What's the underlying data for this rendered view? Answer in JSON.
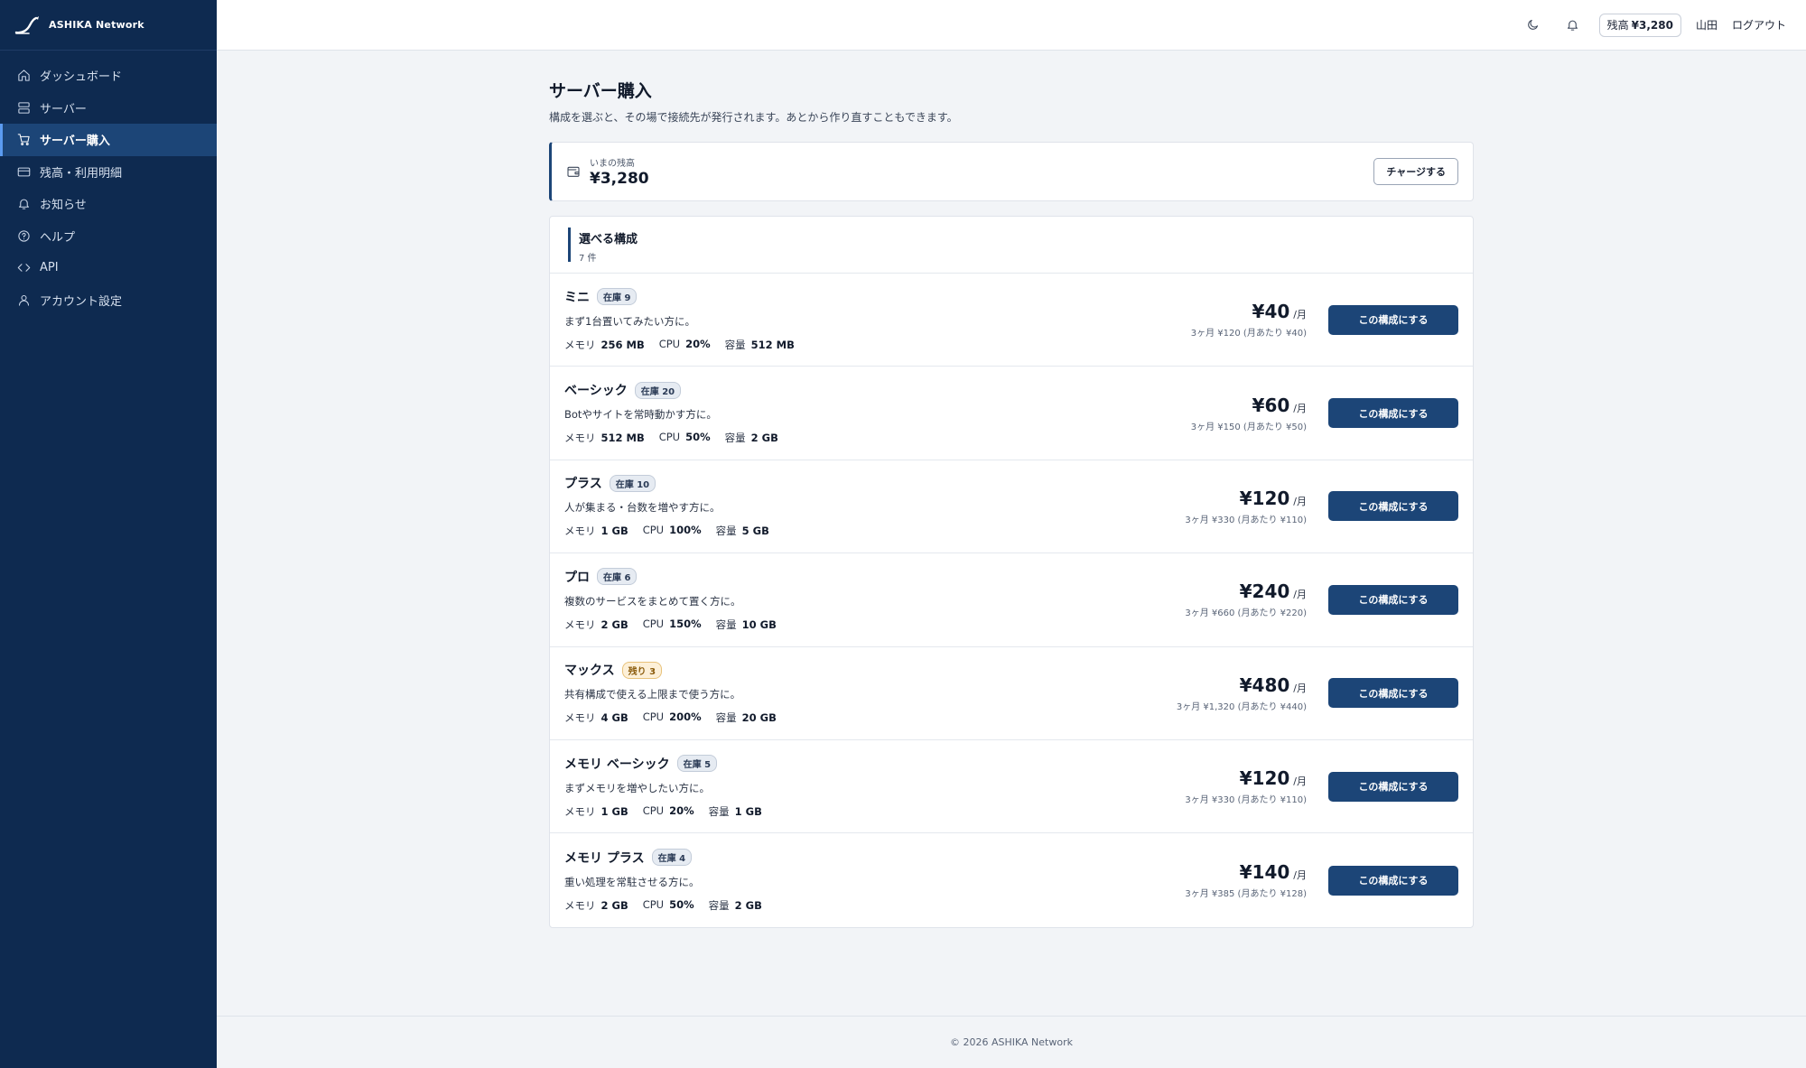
{
  "brand": {
    "name": "ASHIKA Network"
  },
  "nav": [
    {
      "label": "ダッシュボード",
      "icon": "home-icon",
      "active": false
    },
    {
      "label": "サーバー",
      "icon": "server-icon",
      "active": false
    },
    {
      "label": "サーバー購入",
      "icon": "cart-icon",
      "active": true
    },
    {
      "label": "残高・利用明細",
      "icon": "credit-card-icon",
      "active": false
    },
    {
      "label": "お知らせ",
      "icon": "bell-icon",
      "active": false
    },
    {
      "label": "ヘルプ",
      "icon": "help-circle-icon",
      "active": false
    },
    {
      "label": "API",
      "icon": "code-icon",
      "active": false
    },
    {
      "label": "アカウント設定",
      "icon": "user-icon",
      "active": false
    }
  ],
  "header": {
    "balance_label": "残高",
    "balance_value": "¥3,280",
    "user": "山田",
    "logout": "ログアウト"
  },
  "page": {
    "title": "サーバー購入",
    "description": "構成を選ぶと、その場で接続先が発行されます。あとから作り直すこともできます。"
  },
  "balance_card": {
    "label": "いまの残高",
    "amount": "¥3,280",
    "charge_label": "チャージする"
  },
  "plans": {
    "title": "選べる構成",
    "count": "7 件",
    "select_label": "この構成にする",
    "per_month": "/月",
    "spec_labels": {
      "memory": "メモリ",
      "cpu": "CPU",
      "storage": "容量"
    },
    "items": [
      {
        "name": "ミニ",
        "badge": "在庫 9",
        "badge_low": false,
        "desc": "まず1台置いてみたい方に。",
        "memory": "256 MB",
        "cpu": "20%",
        "storage": "512 MB",
        "price": "¥40",
        "sub": "3ヶ月 ¥120 (月あたり ¥40)"
      },
      {
        "name": "ベーシック",
        "badge": "在庫 20",
        "badge_low": false,
        "desc": "Botやサイトを常時動かす方に。",
        "memory": "512 MB",
        "cpu": "50%",
        "storage": "2 GB",
        "price": "¥60",
        "sub": "3ヶ月 ¥150 (月あたり ¥50)"
      },
      {
        "name": "プラス",
        "badge": "在庫 10",
        "badge_low": false,
        "desc": "人が集まる・台数を増やす方に。",
        "memory": "1 GB",
        "cpu": "100%",
        "storage": "5 GB",
        "price": "¥120",
        "sub": "3ヶ月 ¥330 (月あたり ¥110)"
      },
      {
        "name": "プロ",
        "badge": "在庫 6",
        "badge_low": false,
        "desc": "複数のサービスをまとめて置く方に。",
        "memory": "2 GB",
        "cpu": "150%",
        "storage": "10 GB",
        "price": "¥240",
        "sub": "3ヶ月 ¥660 (月あたり ¥220)"
      },
      {
        "name": "マックス",
        "badge": "残り 3",
        "badge_low": true,
        "desc": "共有構成で使える上限まで使う方に。",
        "memory": "4 GB",
        "cpu": "200%",
        "storage": "20 GB",
        "price": "¥480",
        "sub": "3ヶ月 ¥1,320 (月あたり ¥440)"
      },
      {
        "name": "メモリ ベーシック",
        "badge": "在庫 5",
        "badge_low": false,
        "desc": "まずメモリを増やしたい方に。",
        "memory": "1 GB",
        "cpu": "20%",
        "storage": "1 GB",
        "price": "¥120",
        "sub": "3ヶ月 ¥330 (月あたり ¥110)"
      },
      {
        "name": "メモリ プラス",
        "badge": "在庫 4",
        "badge_low": false,
        "desc": "重い処理を常駐させる方に。",
        "memory": "2 GB",
        "cpu": "50%",
        "storage": "2 GB",
        "price": "¥140",
        "sub": "3ヶ月 ¥385 (月あたり ¥128)"
      }
    ]
  },
  "footer": {
    "text": "© 2026 ASHIKA Network"
  }
}
